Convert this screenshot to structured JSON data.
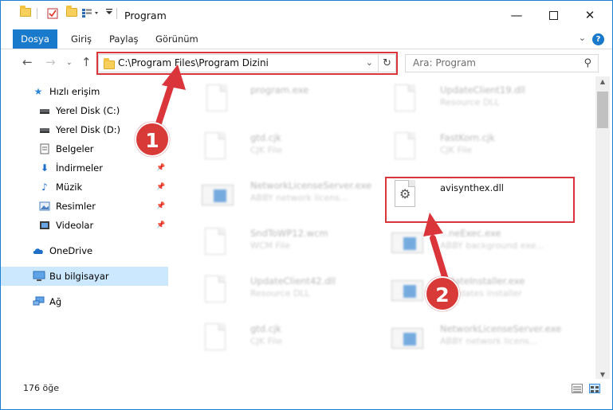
{
  "window": {
    "title": "Program"
  },
  "ribbon": {
    "tabs": [
      "Dosya",
      "Giriş",
      "Paylaş",
      "Görünüm"
    ],
    "help": "?"
  },
  "nav": {
    "address": "C:\\Program Files\\Program Dizini",
    "search_placeholder": "Ara: Program"
  },
  "sidebar": {
    "items": [
      {
        "label": "Hızlı erişim",
        "icon": "star-icon"
      },
      {
        "label": "Yerel Disk (C:)",
        "icon": "drive-icon"
      },
      {
        "label": "Yerel Disk (D:)",
        "icon": "drive-icon"
      },
      {
        "label": "Belgeler",
        "icon": "documents-icon"
      },
      {
        "label": "İndirmeler",
        "icon": "download-icon"
      },
      {
        "label": "Müzik",
        "icon": "music-icon"
      },
      {
        "label": "Resimler",
        "icon": "pictures-icon"
      },
      {
        "label": "Videolar",
        "icon": "videos-icon"
      },
      {
        "label": "OneDrive",
        "icon": "cloud-icon"
      },
      {
        "label": "Bu bilgisayar",
        "icon": "computer-icon"
      },
      {
        "label": "Ağ",
        "icon": "network-icon"
      }
    ]
  },
  "files": {
    "left": [
      {
        "name": "program.exe",
        "type": ""
      },
      {
        "name": "gtd.cjk",
        "type": "CJK File"
      },
      {
        "name": "NetworkLicenseServer.exe",
        "type": "ABBY network licens..."
      },
      {
        "name": "SndToWP12.wcm",
        "type": "WCM File"
      },
      {
        "name": "UpdateClient42.dll",
        "type": "Resource DLL"
      },
      {
        "name": "gtd.cjk",
        "type": "CJK File"
      }
    ],
    "right": [
      {
        "name": "UpdateClient19.dll",
        "type": "Resource DLL"
      },
      {
        "name": "FastKorn.cjk",
        "type": "CJK File"
      },
      {
        "name": "avisynthex.dll",
        "type": ""
      },
      {
        "name": "...neExec.exe",
        "type": "ABBY background exe..."
      },
      {
        "name": "...dateInstaller.exe",
        "type": "...updates installer"
      },
      {
        "name": "NetworkLicenseServer.exe",
        "type": "ABBY network licens..."
      }
    ]
  },
  "status": {
    "count": "176 öğe"
  },
  "annotations": {
    "step1": "1",
    "step2": "2"
  },
  "colors": {
    "accent": "#1979ca",
    "highlight": "#d9353b",
    "selected": "#cce8ff"
  }
}
